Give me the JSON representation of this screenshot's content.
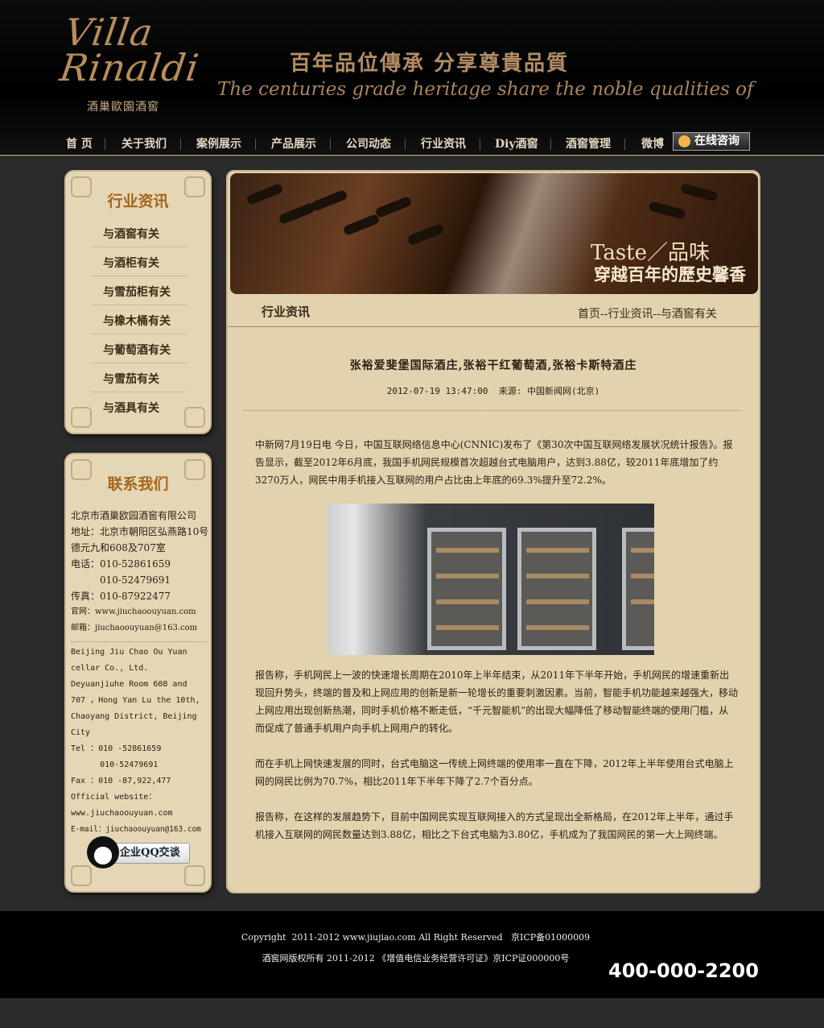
{
  "header": {
    "logo_script": "Villa Rinaldi",
    "logo_cn": "酒巢歐園酒窖",
    "slogan_cn": "百年品位傳承 分享尊貴品質",
    "slogan_en": "The centuries grade heritage share the noble qualities of"
  },
  "nav": {
    "items": [
      "首 页",
      "关于我们",
      "案例展示",
      "产品展示",
      "公司动态",
      "行业资讯",
      "Diy酒窖",
      "酒窖管理",
      "微博"
    ],
    "consult_label": "在线咨询"
  },
  "sidebar": {
    "news_title": "行业资讯",
    "news_items": [
      "与酒窖有关",
      "与酒柜有关",
      "与雪茄柜有关",
      "与橡木桶有关",
      "与葡萄酒有关",
      "与雪茄有关",
      "与酒具有关"
    ],
    "contact_title": "联系我们",
    "contact_cn": [
      "北京市酒巢欧园酒窖有限公司",
      "地址：北京市朝阳区弘燕路10号",
      "德元九和608及707室",
      "电话：010-52861659",
      "　　　010-52479691",
      "传真：010-87922477",
      "官网：www.jiuchaoouyuan.com",
      "邮箱：jiuchaoouyuan@163.com"
    ],
    "contact_en": [
      "Beijing Jiu Chao Ou Yuan",
      "cellar Co., Ltd.",
      "Deyuanjiuhe Room 608 and",
      "707 ，Hong Yan Lu the 10th,",
      "Chaoyang District, Beijing",
      "City",
      "Tel ：010 -52861659",
      "      010-52479691",
      "Fax ：010 -87,922,477",
      "Official website：",
      "www.jiuchaoouyuan.com",
      "E-mail：jiuchaoouyuan@163.com"
    ],
    "qq_label": "企业QQ交谈"
  },
  "main": {
    "banner_t1": "Taste／品味",
    "banner_t2": "穿越百年的歷史馨香",
    "section_title": "行业资讯",
    "breadcrumb": "首页--行业资讯--与酒窖有关",
    "article_title": "张裕爱斐堡国际酒庄,张裕干红葡萄酒,张裕卡斯特酒庄",
    "article_meta": "2012-07-19 13:47:00  来源: 中国新闻网(北京)",
    "p1": "中新网7月19日电 今日，中国互联网络信息中心(CNNIC)发布了《第30次中国互联网络发展状况统计报告》。报告显示，截至2012年6月底，我国手机网民规模首次超越台式电脑用户，达到3.88亿，较2011年底增加了约3270万人，网民中用手机接入互联网的用户占比由上年底的69.3%提升至72.2%。",
    "p2": "报告称，手机网民上一波的快速增长周期在2010年上半年结束，从2011年下半年开始，手机网民的增速重新出现回升势头，终端的普及和上网应用的创新是新一轮增长的重要刺激因素。当前，智能手机功能越来越强大，移动上网应用出现创新热潮，同时手机价格不断走低，“千元智能机”的出现大幅降低了移动智能终端的使用门槛，从而促成了普通手机用户向手机上网用户的转化。",
    "p3": "而在手机上网快速发展的同时，台式电脑这一传统上网终端的使用率一直在下降，2012年上半年使用台式电脑上网的网民比例为70.7%，相比2011年下半年下降了2.7个百分点。",
    "p4": "报告称，在这样的发展趋势下，目前中国网民实现互联网接入的方式呈现出全新格局，在2012年上半年，通过手机接入互联网的网民数量达到3.88亿，相比之下台式电脑为3.80亿，手机成为了我国网民的第一大上网终端。"
  },
  "footer": {
    "copy1": "Copyright  2011-2012 www.jiujiao.com All Right Reserved   京ICP备01000009",
    "copy2": "酒窖网版权所有 2011-2012 《增值电信业务经营许可证》京ICP证000000号",
    "phone": "400-000-2200"
  }
}
